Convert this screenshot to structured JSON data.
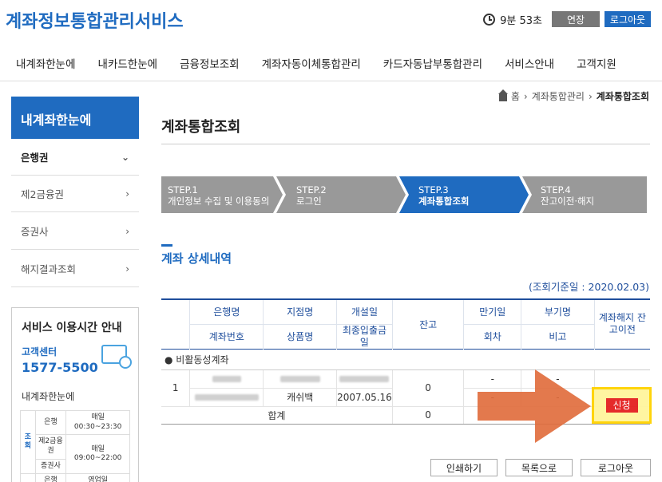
{
  "header": {
    "site_title": "계좌정보통합관리서비스",
    "timer": "9분 53초",
    "extend_label": "연장",
    "logout_label": "로그아웃"
  },
  "gnb": [
    "내계좌한눈에",
    "내카드한눈에",
    "금융정보조회",
    "계좌자동이체통합관리",
    "카드자동납부통합관리",
    "서비스안내",
    "고객지원"
  ],
  "lnb": {
    "title": "내계좌한눈에",
    "items": [
      {
        "label": "은행권",
        "chevron": "down"
      },
      {
        "label": "제2금융권",
        "chevron": "right"
      },
      {
        "label": "증권사",
        "chevron": "right"
      },
      {
        "label": "해지결과조회",
        "chevron": "right"
      }
    ]
  },
  "service_info": {
    "title": "서비스 이용시간 안내",
    "center_label": "고객센터",
    "center_phone": "1577-5500",
    "sub_title": "내계좌한눈에",
    "table": {
      "group": "조회",
      "rows": [
        {
          "org": "은행",
          "time": "매일 00:30~23:30"
        },
        {
          "org": "제2금융권",
          "time": "매일 09:00~22:00"
        },
        {
          "org": "증권사",
          "time": ""
        },
        {
          "org": "은행",
          "time": "영업일"
        }
      ]
    }
  },
  "breadcrumb": {
    "home": "홈",
    "level1": "계좌통합관리",
    "current": "계좌통합조회"
  },
  "page_title": "계좌통합조회",
  "steps": [
    {
      "step": "STEP.1",
      "label": "개인정보 수집 및 이용동의",
      "active": false
    },
    {
      "step": "STEP.2",
      "label": "로그인",
      "active": false
    },
    {
      "step": "STEP.3",
      "label": "계좌통합조회",
      "active": true
    },
    {
      "step": "STEP.4",
      "label": "잔고이전·해지",
      "active": false
    }
  ],
  "section_title": "계좌 상세내역",
  "base_date": "(조회기준일 : 2020.02.03)",
  "table": {
    "headers": {
      "bank": "은행명",
      "account_no": "계좌번호",
      "branch": "지점명",
      "product": "상품명",
      "open_date": "개설일",
      "last_tx": "최종입출금일",
      "balance": "잔고",
      "maturity": "만기일",
      "installment": "회차",
      "dept": "부기명",
      "remark": "비고",
      "action": "계좌해지 잔고이전"
    },
    "group_label": "비활동성계좌",
    "row": {
      "no": "1",
      "product": "캐쉬백",
      "last_tx": "2007.05.16",
      "balance": "0",
      "maturity": "-",
      "installment": "-",
      "dept": "-",
      "remark": "-",
      "apply_label": "신청"
    },
    "total_label": "합계",
    "total_balance": "0"
  },
  "buttons": {
    "print": "인쇄하기",
    "list": "목록으로",
    "logout": "로그아웃"
  },
  "colors": {
    "brand": "#1f6bc0",
    "step_active": "#1f6bc0",
    "step_inactive": "#999999",
    "apply": "#e41f1f",
    "highlight": "#ffd200",
    "arrow": "#e06a3a"
  }
}
